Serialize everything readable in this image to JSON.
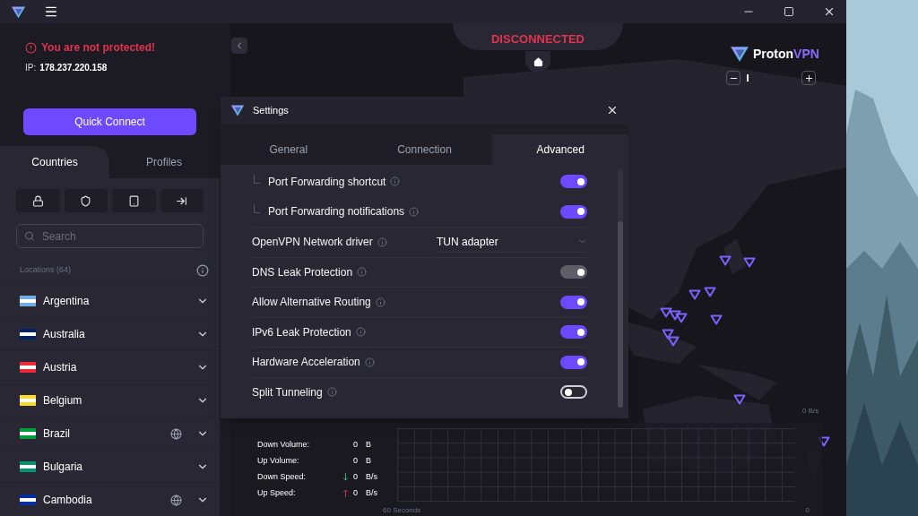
{
  "sidebar": {
    "alert": "You are not protected!",
    "ip_label": "IP:",
    "ip": "178.237.220.158",
    "quick_connect": "Quick Connect",
    "tabs": [
      {
        "label": "Countries",
        "selected": true
      },
      {
        "label": "Profiles",
        "selected": false
      }
    ],
    "search": {
      "placeholder": "Search"
    },
    "locations_label": "Locations (64)",
    "countries": [
      {
        "name": "Argentina",
        "streaming": false,
        "color": "#74acdf"
      },
      {
        "name": "Australia",
        "streaming": false,
        "color": "#012169"
      },
      {
        "name": "Austria",
        "streaming": false,
        "color": "#ed2939"
      },
      {
        "name": "Belgium",
        "streaming": false,
        "color": "#fdda24"
      },
      {
        "name": "Brazil",
        "streaming": true,
        "color": "#009c3b"
      },
      {
        "name": "Bulgaria",
        "streaming": false,
        "color": "#00966e"
      },
      {
        "name": "Cambodia",
        "streaming": true,
        "color": "#032ea1"
      }
    ]
  },
  "status": "DISCONNECTED",
  "logo": {
    "name": "Proton",
    "suffix": "VPN"
  },
  "zoom_slider": {
    "level": 0.05
  },
  "stats": [
    {
      "label": "Down Volume:",
      "value": "0",
      "unit": "B",
      "kind": "plain"
    },
    {
      "label": "Up Volume:",
      "value": "0",
      "unit": "B",
      "kind": "plain"
    },
    {
      "label": "Down Speed:",
      "value": "0",
      "unit": "B/s",
      "kind": "down"
    },
    {
      "label": "Up Speed:",
      "value": "0",
      "unit": "B/s",
      "kind": "up"
    }
  ],
  "graph": {
    "top_label": "0 B/s",
    "x_label": "60 Seconds",
    "end_label": "0"
  },
  "settings": {
    "title": "Settings",
    "tabs": [
      {
        "label": "General",
        "selected": false
      },
      {
        "label": "Connection",
        "selected": false
      },
      {
        "label": "Advanced",
        "selected": true
      }
    ],
    "rows": [
      {
        "label": "Port Forwarding shortcut",
        "kind": "toggle",
        "sub": true,
        "on": true,
        "disabled": false
      },
      {
        "label": "Port Forwarding notifications",
        "kind": "toggle",
        "sub": true,
        "on": true,
        "disabled": false
      },
      {
        "label": "OpenVPN Network driver",
        "kind": "select",
        "sub": false,
        "value": "TUN adapter"
      },
      {
        "label": "DNS Leak Protection",
        "kind": "toggle",
        "sub": false,
        "on": true,
        "disabled": true
      },
      {
        "label": "Allow Alternative Routing",
        "kind": "toggle",
        "sub": false,
        "on": true,
        "disabled": false
      },
      {
        "label": "IPv6 Leak Protection",
        "kind": "toggle",
        "sub": false,
        "on": true,
        "disabled": false
      },
      {
        "label": "Hardware Acceleration",
        "kind": "toggle",
        "sub": false,
        "on": true,
        "disabled": false
      },
      {
        "label": "Split Tunneling",
        "kind": "toggle",
        "sub": false,
        "on": false,
        "disabled": false
      }
    ]
  }
}
